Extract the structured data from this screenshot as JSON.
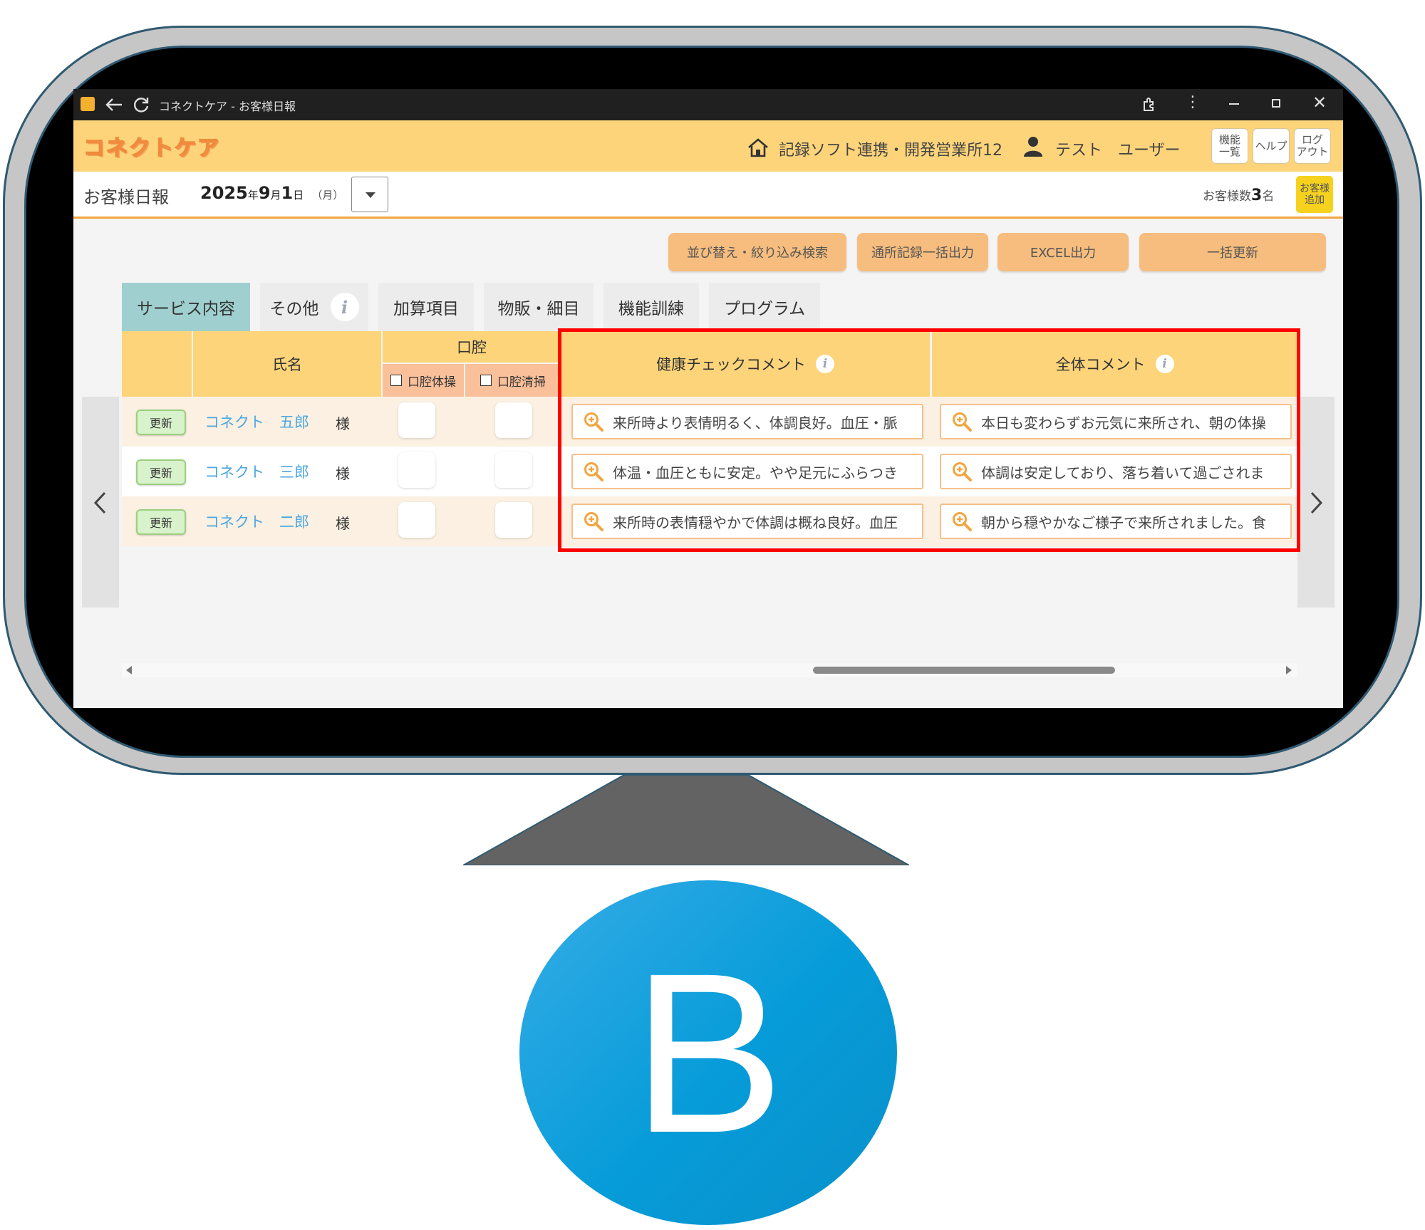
{
  "window": {
    "title": "コネクトケア - お客様日報",
    "controls": [
      "extensions",
      "more",
      "minimize",
      "maximize",
      "close"
    ]
  },
  "header": {
    "logo_text": "コネクトケア",
    "office": "記録ソフト連携・開発営業所12",
    "user": "テスト　ユーザー",
    "buttons": {
      "functions": [
        "機能",
        "一覧"
      ],
      "help": "ヘルプ",
      "logout": [
        "ログ",
        "アウト"
      ]
    }
  },
  "subbar": {
    "page_title": "お客様日報",
    "date": {
      "year": "2025",
      "y": "年",
      "month": "9",
      "m": "月",
      "day": "1",
      "d": "日",
      "weekday": "（月）"
    },
    "customer_count_label": "お客様数",
    "customer_count": "3",
    "customer_count_unit": "名",
    "add_customer": [
      "お客様",
      "追加"
    ]
  },
  "actions": [
    "並び替え・絞り込み検索",
    "通所記録一括出力",
    "EXCEL出力",
    "一括更新"
  ],
  "tabs": [
    {
      "label": "サービス内容",
      "active": true
    },
    {
      "label": "その他",
      "info": true
    },
    {
      "label": "加算項目"
    },
    {
      "label": "物販・細目"
    },
    {
      "label": "機能訓練"
    },
    {
      "label": "プログラム"
    }
  ],
  "table": {
    "headers": {
      "name": "氏名",
      "oral": "口腔",
      "oral_exercise": "口腔体操",
      "oral_cleaning": "口腔清掃",
      "health_comment": "健康チェックコメント",
      "overall_comment": "全体コメント"
    },
    "update_label": "更新",
    "honorific": "様",
    "rows": [
      {
        "name": "コネクト　五郎",
        "health": "来所時より表情明るく、体調良好。血圧・脈",
        "overall": "本日も変わらずお元気に来所され、朝の体操"
      },
      {
        "name": "コネクト　三郎",
        "health": "体温・血圧ともに安定。やや足元にふらつき",
        "overall": "体調は安定しており、落ち着いて過ごされま"
      },
      {
        "name": "コネクト　二郎",
        "health": "来所時の表情穏やかで体調は概ね良好。血圧",
        "overall": "朝から穏やかなご様子で来所されました。食"
      }
    ]
  },
  "badge": {
    "letter": "B"
  },
  "colors": {
    "header": "#fdd47a",
    "highlight": "#ff0000",
    "badge": "#069cd9",
    "accent_orange": "#f2a53f"
  }
}
